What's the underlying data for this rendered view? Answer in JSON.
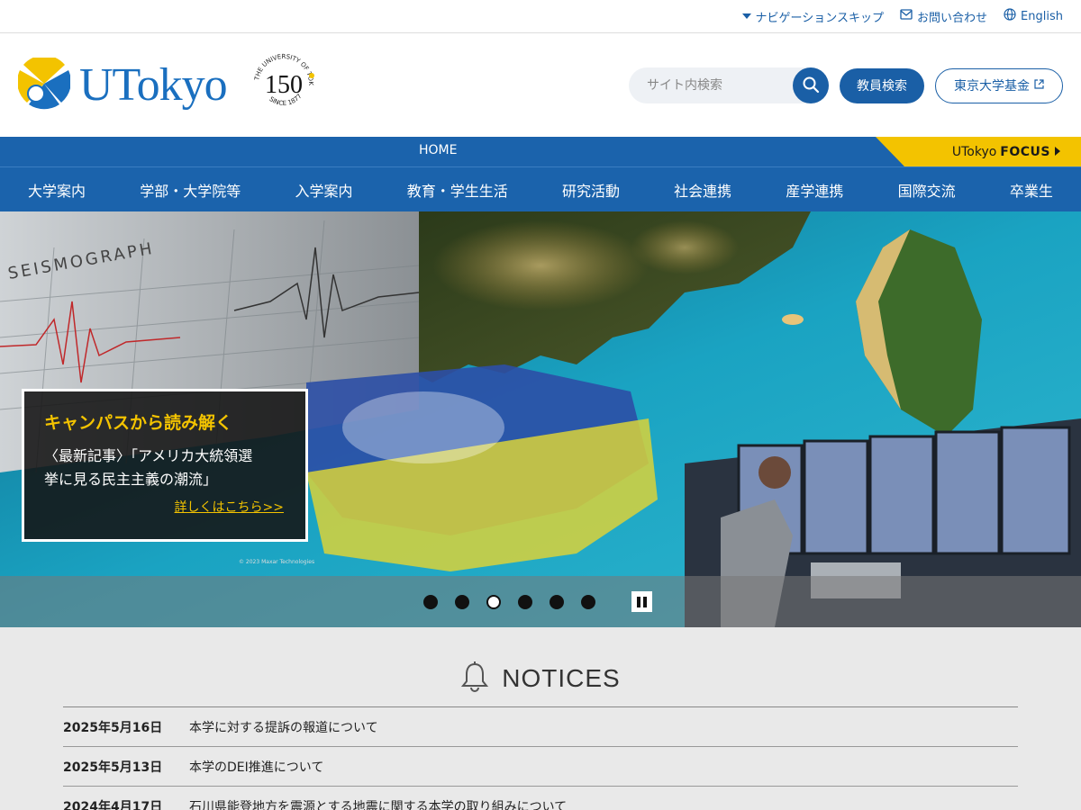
{
  "utility": {
    "nav_skip": "ナビゲーションスキップ",
    "contact": "お問い合わせ",
    "english": "English"
  },
  "header": {
    "logo_text": "UTokyo",
    "badge_number": "150",
    "badge_top": "THE UNIVERSITY OF TOKYO",
    "badge_bottom": "SINCE 1877",
    "search_placeholder": "サイト内検索",
    "faculty_search_label": "教員検索",
    "foundation_label": "東京大学基金"
  },
  "nav": {
    "home": "HOME",
    "focus_prefix": "UTokyo",
    "focus_strong": "FOCUS",
    "items": [
      "大学案内",
      "学部・大学院等",
      "入学案内",
      "教育・学生生活",
      "研究活動",
      "社会連携",
      "産学連携",
      "国際交流",
      "卒業生"
    ]
  },
  "hero": {
    "seismo_label": "SEISMOGRAPH",
    "caption_title": "キャンパスから読み解く",
    "caption_line1": "〈最新記事〉「アメリカ大統領選",
    "caption_line2": "挙に見る民主主義の潮流」",
    "caption_link": "詳しくはこちら>>",
    "credit": "© 2023 Maxar Technologies",
    "slide_count": 6,
    "active_slide": 3
  },
  "notices": {
    "heading": "NOTICES",
    "items": [
      {
        "date": "2025年5月16日",
        "title": "本学に対する提訴の報道について"
      },
      {
        "date": "2025年5月13日",
        "title": "本学のDEI推進について"
      },
      {
        "date": "2024年4月17日",
        "title": "石川県能登地方を震源とする地震に関する本学の取り組みについて"
      }
    ]
  },
  "colors": {
    "brand_blue": "#1b63ac",
    "accent_yellow": "#f3c300"
  }
}
